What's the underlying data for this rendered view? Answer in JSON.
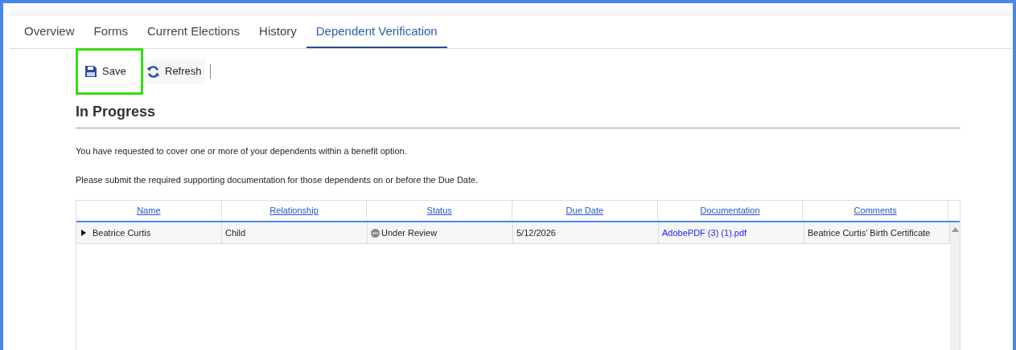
{
  "tabs": [
    {
      "label": "Overview",
      "selected": false
    },
    {
      "label": "Forms",
      "selected": false
    },
    {
      "label": "Current Elections",
      "selected": false
    },
    {
      "label": "History",
      "selected": false
    },
    {
      "label": "Dependent Verification",
      "selected": true
    }
  ],
  "toolbar": [
    {
      "kind": "save",
      "label": "Save",
      "highlighted": true
    },
    {
      "kind": "refresh",
      "label": "Refresh",
      "highlighted": false
    }
  ],
  "section": {
    "title": "In Progress",
    "paragraphs": [
      "You have requested to cover one or more of your dependents within a benefit option.",
      "Please submit the required supporting documentation for those dependents on or before the Due Date."
    ]
  },
  "table": {
    "columns": [
      "Name",
      "Relationship",
      "Status",
      "Due Date",
      "Documentation",
      "Comments"
    ],
    "rows": [
      {
        "expanded": false,
        "name": "Beatrice Curtis",
        "relationship": "Child",
        "status": "Under Review",
        "due_date": "5/12/2026",
        "documentation": "AdobePDF (3) (1).pdf",
        "comments": "Beatrice Curtis' Birth Certificate"
      }
    ]
  }
}
